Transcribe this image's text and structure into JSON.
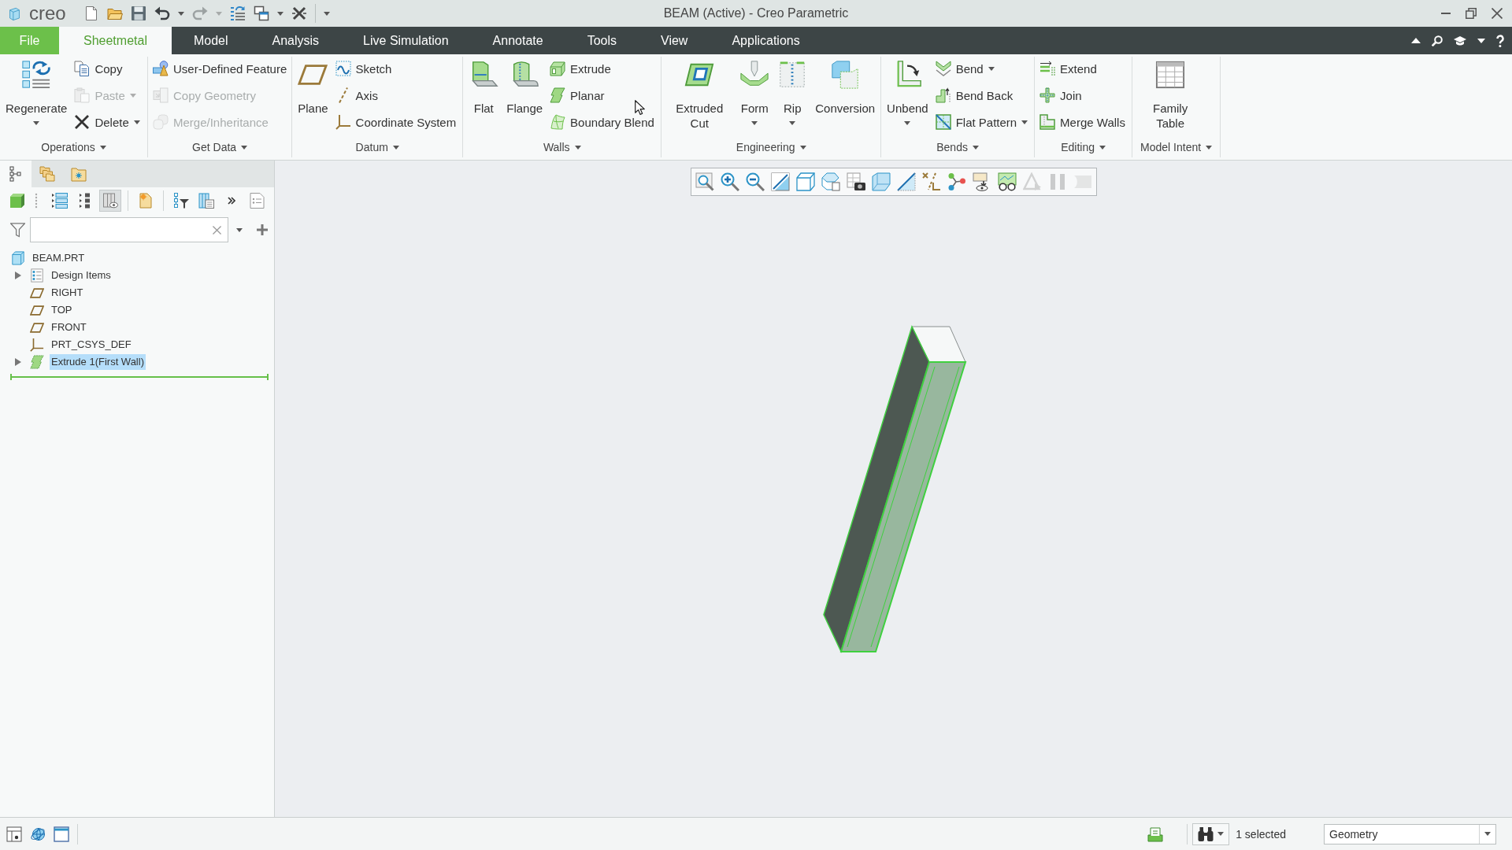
{
  "window": {
    "logo": "creo",
    "title": "BEAM (Active) - Creo Parametric"
  },
  "quick_access": [
    {
      "disabled": false,
      "dropdown": false
    },
    {
      "disabled": false,
      "dropdown": false
    },
    {
      "disabled": false,
      "dropdown": false
    },
    {
      "disabled": false,
      "dropdown": true
    },
    {
      "disabled": true,
      "dropdown": true
    },
    {
      "disabled": false,
      "dropdown": false
    },
    {
      "disabled": false,
      "dropdown": true
    },
    {
      "disabled": false,
      "dropdown": false
    }
  ],
  "menu_tabs": [
    {
      "label": "File",
      "kind": "file",
      "selected": false
    },
    {
      "label": "Sheetmetal",
      "kind": "tab",
      "selected": true
    },
    {
      "label": "Model",
      "kind": "tab",
      "selected": false
    },
    {
      "label": "Analysis",
      "kind": "tab",
      "selected": false
    },
    {
      "label": "Live Simulation",
      "kind": "tab",
      "selected": false
    },
    {
      "label": "Annotate",
      "kind": "tab",
      "selected": false
    },
    {
      "label": "Tools",
      "kind": "tab",
      "selected": false
    },
    {
      "label": "View",
      "kind": "tab",
      "selected": false
    },
    {
      "label": "Applications",
      "kind": "tab",
      "selected": false
    }
  ],
  "ribbon": {
    "groups": [
      {
        "label": "Operations",
        "columns": [
          {
            "kind": "large",
            "label": "Regenerate",
            "dropdown": true,
            "disabled": false
          },
          {
            "kind": "stack",
            "items": [
              {
                "label": "Copy",
                "dropdown": false,
                "disabled": false
              },
              {
                "label": "Paste",
                "dropdown": true,
                "disabled": true
              },
              {
                "label": "Delete",
                "dropdown": true,
                "disabled": false
              }
            ]
          }
        ]
      },
      {
        "label": "Get Data",
        "columns": [
          {
            "kind": "stack",
            "items": [
              {
                "label": "User-Defined Feature",
                "dropdown": false,
                "disabled": false
              },
              {
                "label": "Copy Geometry",
                "dropdown": false,
                "disabled": true
              },
              {
                "label": "Merge/Inheritance",
                "dropdown": false,
                "disabled": true
              }
            ]
          }
        ]
      },
      {
        "label": "Datum",
        "columns": [
          {
            "kind": "large",
            "label": "Plane",
            "dropdown": false,
            "disabled": false
          },
          {
            "kind": "stack",
            "items": [
              {
                "label": "Sketch",
                "dropdown": false,
                "disabled": false
              },
              {
                "label": "Axis",
                "dropdown": false,
                "disabled": false
              },
              {
                "label": "Coordinate System",
                "dropdown": false,
                "disabled": false
              }
            ]
          }
        ]
      },
      {
        "label": "Walls",
        "columns": [
          {
            "kind": "large",
            "label": "Flat",
            "dropdown": false,
            "disabled": false
          },
          {
            "kind": "large",
            "label": "Flange",
            "dropdown": false,
            "disabled": false
          },
          {
            "kind": "stack",
            "items": [
              {
                "label": "Extrude",
                "dropdown": false,
                "disabled": false
              },
              {
                "label": "Planar",
                "dropdown": false,
                "disabled": false
              },
              {
                "label": "Boundary Blend",
                "dropdown": false,
                "disabled": false
              }
            ]
          }
        ]
      },
      {
        "label": "Engineering",
        "columns": [
          {
            "kind": "large",
            "label": "Extruded Cut",
            "dropdown": false,
            "disabled": false
          },
          {
            "kind": "large",
            "label": "Form",
            "dropdown": true,
            "disabled": false
          },
          {
            "kind": "large",
            "label": "Rip",
            "dropdown": true,
            "disabled": false
          },
          {
            "kind": "large",
            "label": "Conversion",
            "dropdown": false,
            "disabled": false
          }
        ]
      },
      {
        "label": "Bends",
        "columns": [
          {
            "kind": "large",
            "label": "Unbend",
            "dropdown": true,
            "disabled": false
          },
          {
            "kind": "stack",
            "items": [
              {
                "label": "Bend",
                "dropdown": true,
                "disabled": false
              },
              {
                "label": "Bend Back",
                "dropdown": false,
                "disabled": false
              },
              {
                "label": "Flat Pattern",
                "dropdown": true,
                "disabled": false
              }
            ]
          }
        ]
      },
      {
        "label": "Editing",
        "columns": [
          {
            "kind": "stack",
            "items": [
              {
                "label": "Extend",
                "dropdown": false,
                "disabled": false
              },
              {
                "label": "Join",
                "dropdown": false,
                "disabled": false
              },
              {
                "label": "Merge Walls",
                "dropdown": false,
                "disabled": false
              }
            ]
          }
        ]
      },
      {
        "label": "Model Intent",
        "columns": [
          {
            "kind": "large",
            "label": "Family Table",
            "dropdown": false,
            "disabled": false
          }
        ]
      }
    ]
  },
  "model_tree": {
    "tabs": [
      {
        "selected": true
      },
      {
        "selected": false
      },
      {
        "selected": false
      }
    ],
    "toolbar": [
      {
        "pressed": false
      },
      {
        "pressed": false
      },
      {
        "pressed": false
      },
      {
        "pressed": true
      },
      {
        "pressed": false
      },
      {
        "pressed": false
      },
      {
        "pressed": false
      },
      {
        "pressed": false
      },
      {
        "pressed": false
      }
    ],
    "root": {
      "label": "BEAM.PRT",
      "kind": "part",
      "selected": false,
      "children": [
        {
          "label": "Design Items",
          "kind": "design_items",
          "selected": false,
          "expanded": false
        },
        {
          "label": "RIGHT",
          "kind": "datum_plane",
          "selected": false
        },
        {
          "label": "TOP",
          "kind": "datum_plane",
          "selected": false
        },
        {
          "label": "FRONT",
          "kind": "datum_plane",
          "selected": false
        },
        {
          "label": "PRT_CSYS_DEF",
          "kind": "coordinate_system",
          "selected": false
        },
        {
          "label": "Extrude 1(First Wall)",
          "kind": "wall",
          "selected": true,
          "expanded": false
        }
      ]
    }
  },
  "view_toolbar": [
    {
      "disabled": false
    },
    {
      "disabled": false
    },
    {
      "disabled": false
    },
    {
      "disabled": false
    },
    {
      "disabled": false
    },
    {
      "disabled": false
    },
    {
      "disabled": false
    },
    {
      "disabled": false
    },
    {
      "disabled": false
    },
    {
      "disabled": false
    },
    {
      "disabled": false
    },
    {
      "disabled": false
    },
    {
      "disabled": false
    },
    {
      "disabled": true
    },
    {
      "disabled": true
    },
    {
      "disabled": true
    }
  ],
  "status_bar": {
    "selection": "1 selected",
    "filter": {
      "value": "Geometry"
    }
  }
}
